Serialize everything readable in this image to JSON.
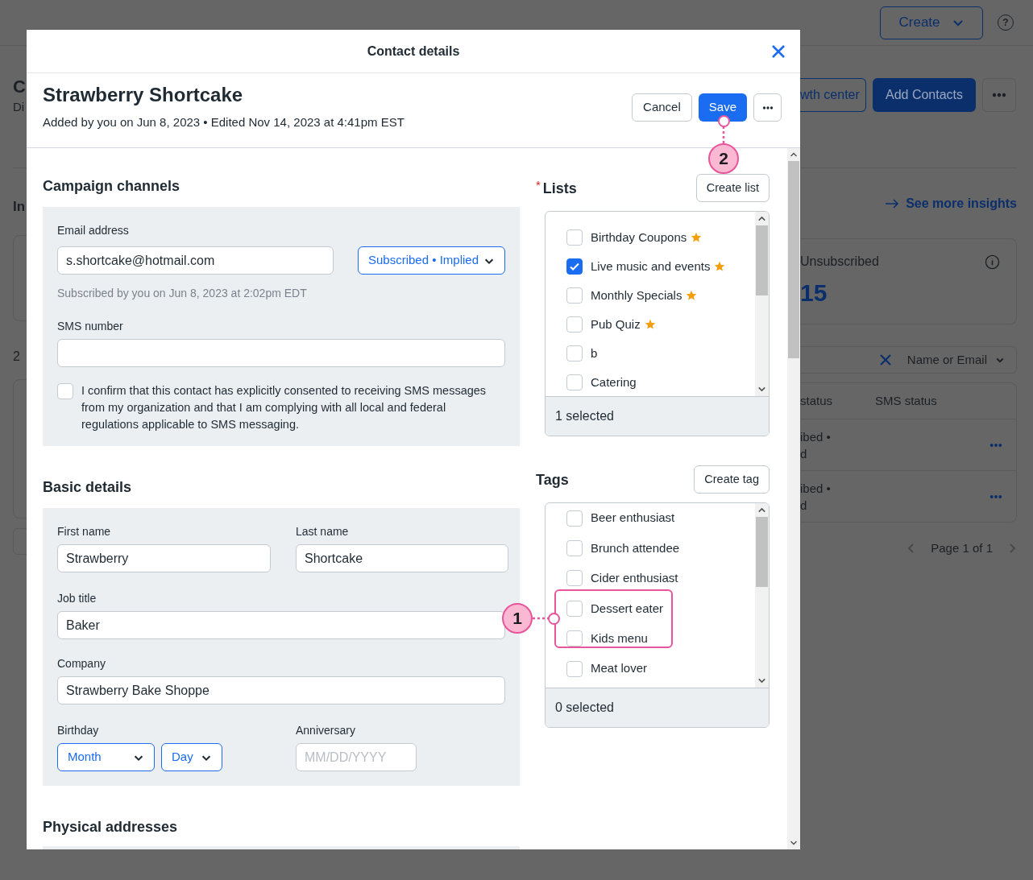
{
  "background": {
    "header": {
      "create_button": "Create",
      "help": "?"
    },
    "page_title": "C",
    "page_subtitle": "Di",
    "actions": [
      "wth center",
      "Add Contacts"
    ],
    "insights_heading": "In",
    "insights_link": "See more insights",
    "stat_card": {
      "label": "Unsubscribed",
      "value": "15"
    },
    "count": "2",
    "search": {
      "scope": "Name or Email"
    },
    "table": {
      "columns": [
        "status",
        "SMS status"
      ],
      "rows": [
        {
          "column_1": [
            "ibed •",
            "d"
          ]
        },
        {
          "column_1": [
            "ibed •",
            "d"
          ]
        }
      ]
    },
    "pagination": "Page 1 of 1"
  },
  "dialog": {
    "title": "Contact details",
    "contact_name": "Strawberry Shortcake",
    "meta": "Added by you on Jun 8, 2023 • Edited Nov 14, 2023 at 4:41pm EST",
    "buttons": [
      {
        "label": "Cancel",
        "kind": "secondary"
      },
      {
        "label": "Save",
        "kind": "primary"
      }
    ],
    "campaign_channels": {
      "heading": "Campaign channels",
      "email": {
        "label": "Email address",
        "value": "s.shortcake@hotmail.com",
        "status": "Subscribed • Implied",
        "note": "Subscribed by you on Jun 8, 2023 at 2:02pm EDT"
      },
      "sms": {
        "label": "SMS number"
      },
      "consent": {
        "text": "I confirm that this contact has explicitly consented to receiving SMS messages from my organization and that I am complying with all local and federal regulations applicable to SMS messaging.",
        "checked": false
      }
    },
    "basic_details": {
      "heading": "Basic details",
      "first_name": {
        "label": "First name",
        "value": "Strawberry"
      },
      "last_name": {
        "label": "Last name",
        "value": "Shortcake"
      },
      "job_title": {
        "label": "Job title",
        "value": "Baker"
      },
      "company": {
        "label": "Company",
        "value": "Strawberry Bake Shoppe"
      },
      "birthday": {
        "label": "Birthday",
        "month": "Month",
        "day": "Day"
      },
      "anniversary": {
        "label": "Anniversary",
        "placeholder": "MM/DD/YYYY"
      }
    },
    "physical_addresses": {
      "heading": "Physical addresses"
    },
    "lists": {
      "required_mark": "*",
      "heading": "Lists",
      "create_button": "Create list",
      "items": [
        {
          "label": "Birthday Coupons",
          "checked": false,
          "starred": true
        },
        {
          "label": "Live music and events",
          "checked": true,
          "starred": true
        },
        {
          "label": "Monthly Specials",
          "checked": false,
          "starred": true
        },
        {
          "label": "Pub Quiz",
          "checked": false,
          "starred": true
        },
        {
          "label": "b",
          "checked": false,
          "starred": false
        },
        {
          "label": "Catering",
          "checked": false,
          "starred": false
        }
      ],
      "summary": "1 selected"
    },
    "tags": {
      "heading": "Tags",
      "create_button": "Create tag",
      "items": [
        {
          "label": "Beer enthusiast",
          "checked": false
        },
        {
          "label": "Brunch attendee",
          "checked": false
        },
        {
          "label": "Cider enthusiast",
          "checked": false
        },
        {
          "label": "Dessert eater",
          "checked": false
        },
        {
          "label": "Kids menu",
          "checked": false
        },
        {
          "label": "Meat lover",
          "checked": false
        }
      ],
      "summary": "0 selected"
    }
  },
  "callouts": [
    {
      "number": "1"
    },
    {
      "number": "2"
    }
  ]
}
